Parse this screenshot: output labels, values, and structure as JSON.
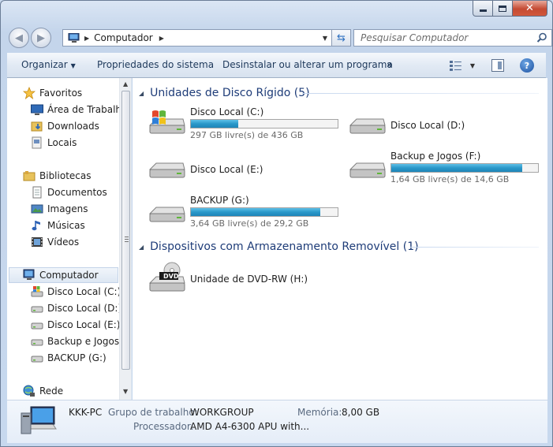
{
  "window": {
    "colors": {
      "accent": "#1e3c78",
      "capacity": "#2a98c9",
      "close": "#c44a33"
    }
  },
  "address": {
    "location": "Computador"
  },
  "search": {
    "placeholder": "Pesquisar Computador"
  },
  "toolbar": {
    "organize_label": "Organizar",
    "properties_label": "Propriedades do sistema",
    "uninstall_label": "Desinstalar ou alterar um programa",
    "more_label": "»"
  },
  "nav": {
    "favorites": {
      "label": "Favoritos",
      "items": [
        "Área de Trabalho",
        "Downloads",
        "Locais"
      ]
    },
    "libraries": {
      "label": "Bibliotecas",
      "items": [
        "Documentos",
        "Imagens",
        "Músicas",
        "Vídeos"
      ]
    },
    "computer": {
      "label": "Computador",
      "items": [
        "Disco Local (C:)",
        "Disco Local (D:)",
        "Disco Local (E:)",
        "Backup e Jogos (",
        "BACKUP (G:)"
      ]
    },
    "network": {
      "label": "Rede"
    }
  },
  "content": {
    "hdd_group": "Unidades de Disco Rígido (5)",
    "removable_group": "Dispositivos com Armazenamento Removível (1)",
    "drives": [
      {
        "name": "Disco Local (C:)",
        "free_text": "297 GB livre(s) de 436 GB",
        "used_fraction": 0.32,
        "system": true
      },
      {
        "name": "Disco Local (D:)"
      },
      {
        "name": "Backup e Jogos (F:)",
        "free_text": "1,64 GB livre(s) de 14,6 GB",
        "used_fraction": 0.89
      },
      {
        "name": "Disco Local (E:)"
      },
      {
        "name": "BACKUP (G:)",
        "free_text": "3,64 GB livre(s) de 29,2 GB",
        "used_fraction": 0.88
      }
    ],
    "dvd": {
      "name": "Unidade de DVD-RW (H:)",
      "icon_text": "DVD"
    }
  },
  "details": {
    "pc_name": "KKK-PC",
    "workgroup_label": "Grupo de trabalho:",
    "workgroup_value": "WORKGROUP",
    "memory_label": "Memória:",
    "memory_value": "8,00 GB",
    "processor_label": "Processador:",
    "processor_value": "AMD A4-6300 APU with..."
  }
}
